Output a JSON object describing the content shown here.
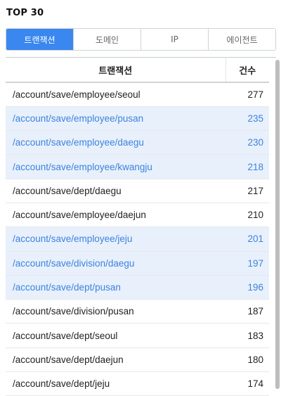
{
  "title": "TOP 30",
  "tabs": [
    {
      "label": "트랜잭션",
      "active": true
    },
    {
      "label": "도메인",
      "active": false
    },
    {
      "label": "IP",
      "active": false
    },
    {
      "label": "에이전트",
      "active": false
    }
  ],
  "table": {
    "headers": {
      "name": "트랜잭션",
      "count": "건수"
    },
    "rows": [
      {
        "name": "/account/save/employee/seoul",
        "count": "277",
        "highlight": false
      },
      {
        "name": "/account/save/employee/pusan",
        "count": "235",
        "highlight": true
      },
      {
        "name": "/account/save/employee/daegu",
        "count": "230",
        "highlight": true
      },
      {
        "name": "/account/save/employee/kwangju",
        "count": "218",
        "highlight": true
      },
      {
        "name": "/account/save/dept/daegu",
        "count": "217",
        "highlight": false
      },
      {
        "name": "/account/save/employee/daejun",
        "count": "210",
        "highlight": false
      },
      {
        "name": "/account/save/employee/jeju",
        "count": "201",
        "highlight": true
      },
      {
        "name": "/account/save/division/daegu",
        "count": "197",
        "highlight": true
      },
      {
        "name": "/account/save/dept/pusan",
        "count": "196",
        "highlight": true
      },
      {
        "name": "/account/save/division/pusan",
        "count": "187",
        "highlight": false
      },
      {
        "name": "/account/save/dept/seoul",
        "count": "183",
        "highlight": false
      },
      {
        "name": "/account/save/dept/daejun",
        "count": "180",
        "highlight": false
      },
      {
        "name": "/account/save/dept/jeju",
        "count": "174",
        "highlight": false
      }
    ]
  },
  "colors": {
    "accent": "#3a87f0",
    "highlight_bg": "#e8f0fc",
    "highlight_text": "#3d83dc"
  }
}
